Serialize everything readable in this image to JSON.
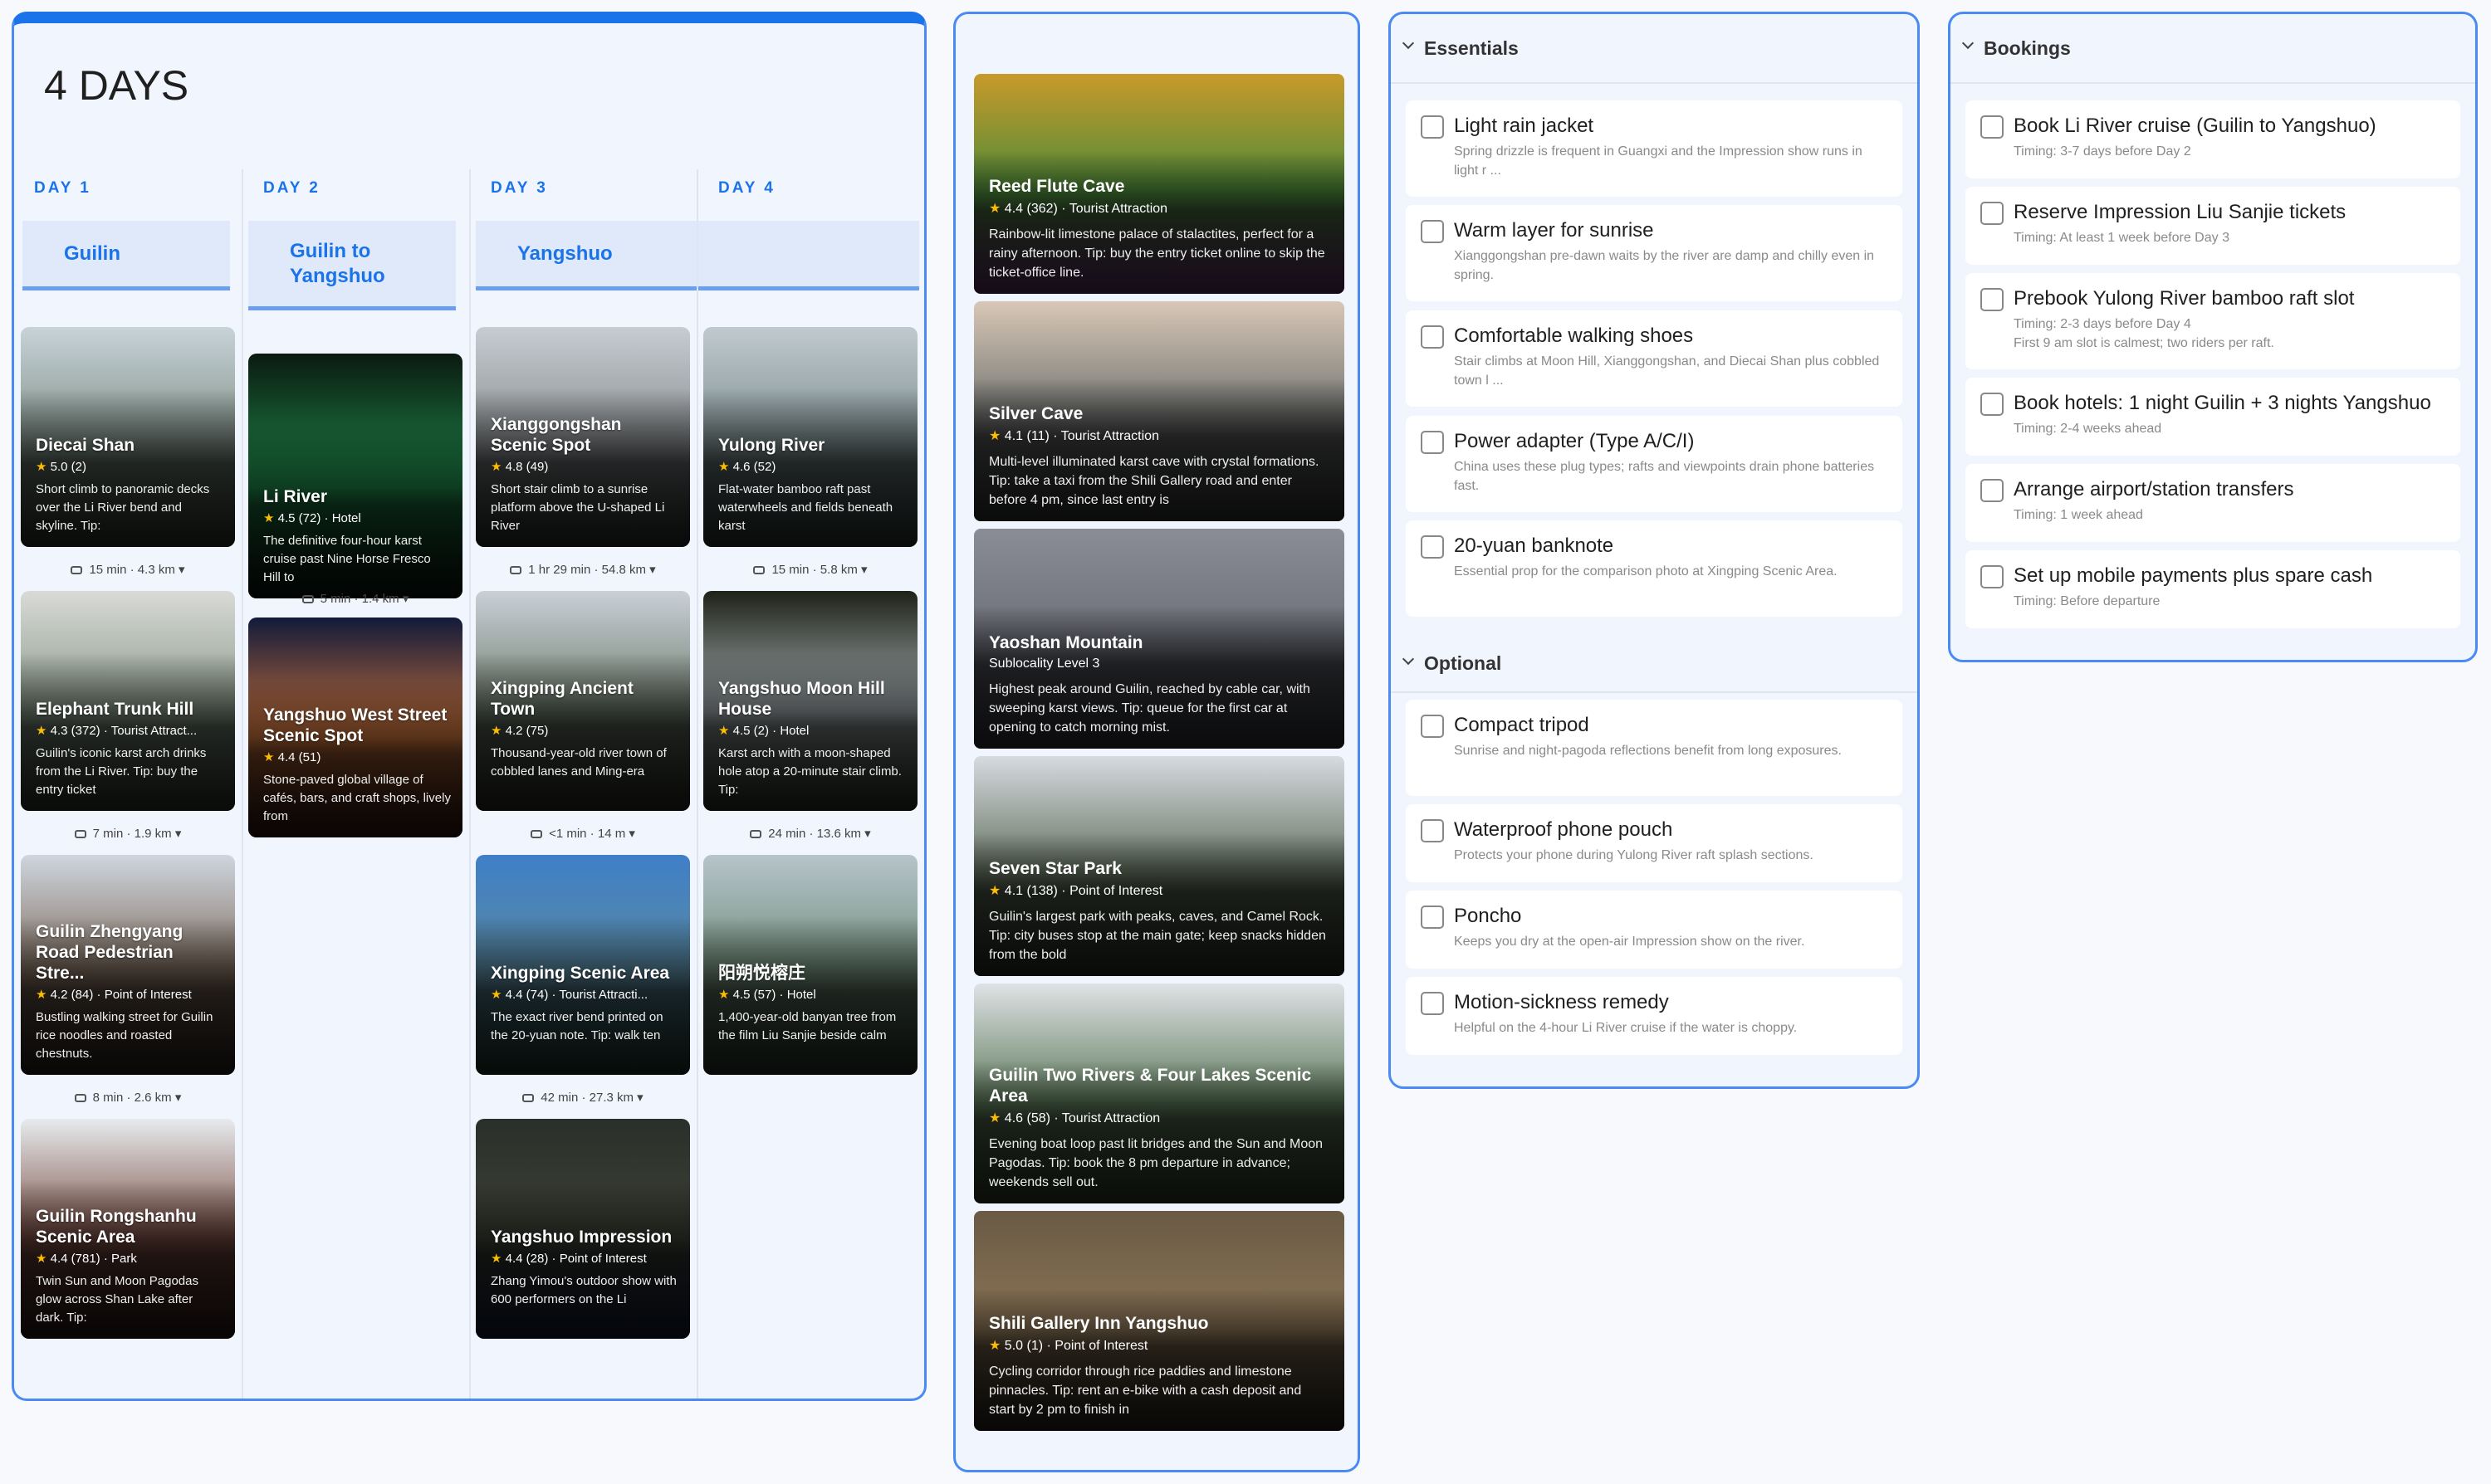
{
  "itinerary": {
    "title": "4 DAYS",
    "days": [
      {
        "label": "DAY 1",
        "region": "Guilin",
        "cards": [
          {
            "name": "Diecai Shan",
            "rating": "5.0",
            "reviews": "(2)",
            "category": "",
            "desc": "Short climb to panoramic decks over the Li River bend and skyline. Tip:",
            "travel": "15 min · 4.3 km",
            "colors": [
              "#c8d3d8",
              "#7f8f86",
              "#3e4a3c"
            ]
          },
          {
            "name": "Elephant Trunk Hill",
            "rating": "4.3",
            "reviews": "(372)",
            "category": "Tourist Attract...",
            "desc": "Guilin's iconic karst arch drinks from the Li River. Tip: buy the entry ticket",
            "travel": "7 min · 1.9 km",
            "colors": [
              "#d9dad7",
              "#8a9a8a",
              "#3d4a3b"
            ]
          },
          {
            "name": "Guilin Zhengyang Road Pedestrian Stre...",
            "rating": "4.2",
            "reviews": "(84)",
            "category": "Point of Interest",
            "desc": "Bustling walking street for Guilin rice noodles and roasted chestnuts.",
            "travel": "8 min · 2.6 km",
            "colors": [
              "#cfd6df",
              "#7d6a5a",
              "#3a2e28"
            ]
          },
          {
            "name": "Guilin Rongshanhu Scenic Area",
            "rating": "4.4",
            "reviews": "(781)",
            "category": "Park",
            "desc": "Twin Sun and Moon Pagodas glow across Shan Lake after dark. Tip:",
            "travel": "",
            "colors": [
              "#e7ebee",
              "#7a4c42",
              "#3b2420"
            ]
          }
        ]
      },
      {
        "label": "DAY 2",
        "region": "Guilin to Yangshuo",
        "cards": [
          {
            "name": "Li River",
            "rating": "4.5",
            "reviews": "(72)",
            "category": "Hotel",
            "desc": "The definitive four-hour karst cruise past Nine Horse Fresco Hill to",
            "travel": "5 min · 1.4 km",
            "colors": [
              "#0b1a10",
              "#1e8a4a",
              "#0a1a12"
            ]
          },
          {
            "name": "Yangshuo West Street Scenic Spot",
            "rating": "4.4",
            "reviews": "(51)",
            "category": "",
            "desc": "Stone-paved global village of cafés, bars, and craft shops, lively from",
            "travel": "",
            "colors": [
              "#121a3a",
              "#c9723a",
              "#3a1a14"
            ]
          }
        ]
      },
      {
        "label": "DAY 3",
        "region": "Yangshuo",
        "cards": [
          {
            "name": "Xianggongshan Scenic Spot",
            "rating": "4.8",
            "reviews": "(49)",
            "category": "",
            "desc": "Short stair climb to a sunrise platform above the U-shaped Li River",
            "travel": "1 hr 29 min · 54.8 km",
            "colors": [
              "#c7ccd2",
              "#8a8e90",
              "#3a3e3e"
            ]
          },
          {
            "name": "Xingping Ancient Town",
            "rating": "4.2",
            "reviews": "(75)",
            "category": "",
            "desc": "Thousand-year-old river town of cobbled lanes and Ming-era",
            "travel": "<1 min · 14 m",
            "colors": [
              "#c9d0d6",
              "#6f7d6e",
              "#3a3f36"
            ]
          },
          {
            "name": "Xingping Scenic Area",
            "rating": "4.4",
            "reviews": "(74)",
            "category": "Tourist Attracti...",
            "desc": "The exact river bend printed on the 20-yuan note. Tip: walk ten",
            "travel": "42 min · 27.3 km",
            "colors": [
              "#3f7fc8",
              "#5b8aa0",
              "#2a4a3a"
            ]
          },
          {
            "name": "Yangshuo Impression",
            "rating": "4.4",
            "reviews": "(28)",
            "category": "Point of Interest",
            "desc": "Zhang Yimou's outdoor show with 600 performers on the Li",
            "travel": "",
            "colors": [
              "#2b2f2a",
              "#3d4236",
              "#1c2a4a"
            ]
          }
        ]
      },
      {
        "label": "DAY 4",
        "region": "",
        "cards": [
          {
            "name": "Yulong River",
            "rating": "4.6",
            "reviews": "(52)",
            "category": "",
            "desc": "Flat-water bamboo raft past waterwheels and fields beneath karst",
            "travel": "15 min · 5.8 km",
            "colors": [
              "#c0c9cf",
              "#7e8f90",
              "#3a4a46"
            ]
          },
          {
            "name": "Yangshuo Moon Hill House",
            "rating": "4.5",
            "reviews": "(2)",
            "category": "Hotel",
            "desc": "Karst arch with a moon-shaped hole atop a 20-minute stair climb. Tip:",
            "travel": "24 min · 13.6 km",
            "colors": [
              "#1e2218",
              "#a9b2b6",
              "#3c4636"
            ]
          },
          {
            "name": "阳朔悦榕庄",
            "rating": "4.5",
            "reviews": "(57)",
            "category": "Hotel",
            "desc": "1,400-year-old banyan tree from the film Liu Sanjie beside calm",
            "travel": "",
            "colors": [
              "#b7c4cc",
              "#6f8d78",
              "#39483c"
            ]
          }
        ]
      }
    ]
  },
  "suggestions": [
    {
      "name": "Reed Flute Cave",
      "rating": "4.4",
      "reviews": "(362)",
      "category": "Tourist Attraction",
      "desc": "Rainbow-lit limestone palace of stalactites, perfect for a rainy afternoon. Tip: buy the entry ticket online to skip the ticket-office line.",
      "colors": [
        "#c89a2a",
        "#4a8a3a",
        "#7a3a8a"
      ]
    },
    {
      "name": "Silver Cave",
      "rating": "4.1",
      "reviews": "(11)",
      "category": "Tourist Attraction",
      "desc": "Multi-level illuminated karst cave with crystal formations. Tip: take a taxi from the Shili Gallery road and enter before 4 pm, since last entry is",
      "colors": [
        "#d8c7b6",
        "#6f7270",
        "#3a403c"
      ]
    },
    {
      "name": "Yaoshan Mountain",
      "rating": "",
      "reviews": "",
      "category": "Sublocality Level 3",
      "desc": "Highest peak around Guilin, reached by cable car, with sweeping karst views. Tip: queue for the first car at opening to catch morning mist.",
      "colors": [
        "#8a8c96",
        "#6a6c76",
        "#3a3c46"
      ]
    },
    {
      "name": "Seven Star Park",
      "rating": "4.1",
      "reviews": "(138)",
      "category": "Point of Interest",
      "desc": "Guilin's largest park with peaks, caves, and Camel Rock. Tip: city buses stop at the main gate; keep snacks hidden from the bold",
      "colors": [
        "#d6dbe0",
        "#5f6d5a",
        "#2f3a2c"
      ]
    },
    {
      "name": "Guilin Two Rivers & Four Lakes Scenic Area",
      "rating": "4.6",
      "reviews": "(58)",
      "category": "Tourist Attraction",
      "desc": "Evening boat loop past lit bridges and the Sun and Moon Pagodas. Tip: book the 8 pm departure in advance; weekends sell out.",
      "colors": [
        "#dfe2e6",
        "#5d7a5a",
        "#3a4a34"
      ]
    },
    {
      "name": "Shili Gallery Inn Yangshuo",
      "rating": "5.0",
      "reviews": "(1)",
      "category": "Point of Interest",
      "desc": "Cycling corridor through rice paddies and limestone pinnacles. Tip: rent an e-bike with a cash deposit and start by 2 pm to finish in",
      "colors": [
        "#6a5a44",
        "#8a7456",
        "#2f2a22"
      ]
    }
  ],
  "essentials": {
    "heading": "Essentials",
    "items": [
      {
        "title": "Light rain jacket",
        "sub": "Spring drizzle is frequent in Guangxi and the Impression show runs in light r ..."
      },
      {
        "title": "Warm layer for sunrise",
        "sub": "Xianggongshan pre-dawn waits by the river are damp and chilly even in spring."
      },
      {
        "title": "Comfortable walking shoes",
        "sub": "Stair climbs at Moon Hill, Xianggongshan, and Diecai Shan plus cobbled town l ..."
      },
      {
        "title": "Power adapter (Type A/C/I)",
        "sub": "China uses these plug types; rafts and viewpoints drain phone batteries fast."
      },
      {
        "title": "20-yuan banknote",
        "sub": "Essential prop for the comparison photo at Xingping Scenic Area."
      }
    ]
  },
  "optional": {
    "heading": "Optional",
    "items": [
      {
        "title": "Compact tripod",
        "sub": "Sunrise and night-pagoda reflections benefit from long exposures."
      },
      {
        "title": "Waterproof phone pouch",
        "sub": "Protects your phone during Yulong River raft splash sections."
      },
      {
        "title": "Poncho",
        "sub": "Keeps you dry at the open-air Impression show on the river."
      },
      {
        "title": "Motion-sickness remedy",
        "sub": "Helpful on the 4-hour Li River cruise if the water is choppy."
      }
    ]
  },
  "bookings": {
    "heading": "Bookings",
    "items": [
      {
        "title": "Book Li River cruise (Guilin to Yangshuo)",
        "sub": "Timing: 3-7 days before Day 2",
        "sub2": ""
      },
      {
        "title": "Reserve Impression Liu Sanjie tickets",
        "sub": "Timing: At least 1 week before Day 3",
        "sub2": ""
      },
      {
        "title": "Prebook Yulong River bamboo raft slot",
        "sub": "Timing: 2-3 days before Day 4",
        "sub2": "First 9 am slot is calmest; two riders per raft."
      },
      {
        "title": "Book hotels: 1 night Guilin + 3 nights Yangshuo",
        "sub": "Timing: 2-4 weeks ahead",
        "sub2": ""
      },
      {
        "title": "Arrange airport/station transfers",
        "sub": "Timing: 1 week ahead",
        "sub2": ""
      },
      {
        "title": "Set up mobile payments plus spare cash",
        "sub": "Timing: Before departure",
        "sub2": ""
      }
    ]
  },
  "colors": {
    "accent": "#1a73e8",
    "panel_border": "#4a8af4",
    "panel_bg": "#f1f5fd",
    "star": "#fbbc04"
  }
}
